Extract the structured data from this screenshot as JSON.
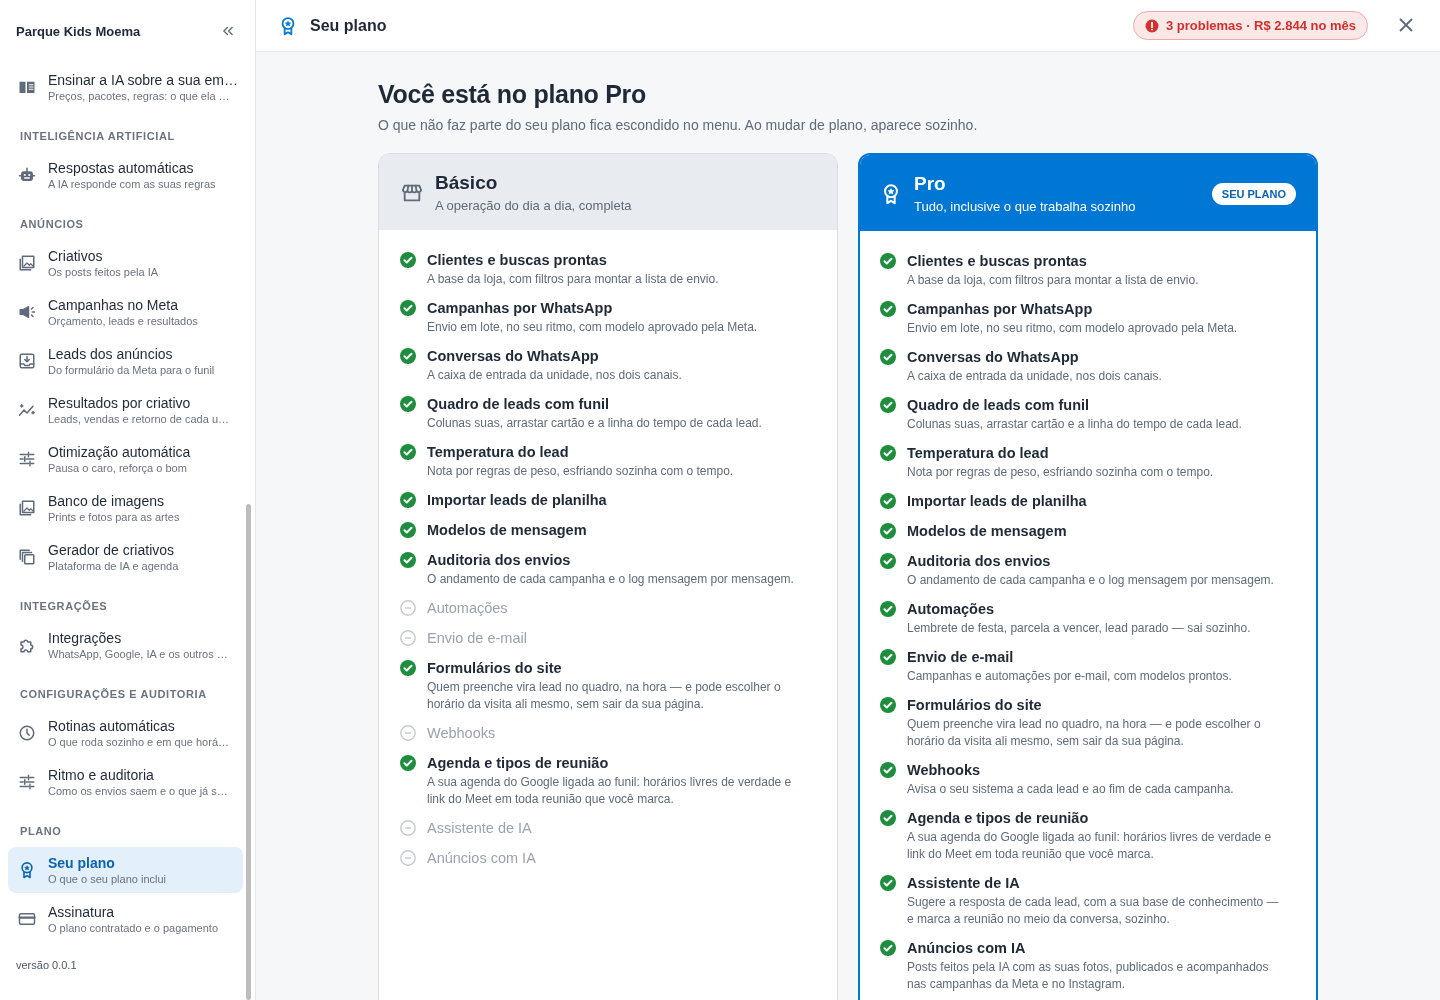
{
  "sidebar": {
    "brand": "Parque Kids Moema",
    "sections": [
      {
        "items": [
          {
            "title": "Ensinar a IA sobre a sua em…",
            "subtitle": "Preços, pacotes, regras: o que ela …",
            "selected": false
          }
        ]
      },
      {
        "heading": "INTELIGÊNCIA ARTIFICIAL",
        "items": [
          {
            "title": "Respostas automáticas",
            "subtitle": "A IA responde com as suas regras",
            "selected": false
          }
        ]
      },
      {
        "heading": "ANÚNCIOS",
        "items": [
          {
            "title": "Criativos",
            "subtitle": "Os posts feitos pela IA",
            "selected": false
          },
          {
            "title": "Campanhas no Meta",
            "subtitle": "Orçamento, leads e resultados",
            "selected": false
          },
          {
            "title": "Leads dos anúncios",
            "subtitle": "Do formulário da Meta para o funil",
            "selected": false
          },
          {
            "title": "Resultados por criativo",
            "subtitle": "Leads, vendas e retorno de cada u…",
            "selected": false
          },
          {
            "title": "Otimização automática",
            "subtitle": "Pausa o caro, reforça o bom",
            "selected": false
          },
          {
            "title": "Banco de imagens",
            "subtitle": "Prints e fotos para as artes",
            "selected": false
          },
          {
            "title": "Gerador de criativos",
            "subtitle": "Plataforma de IA e agenda",
            "selected": false
          }
        ]
      },
      {
        "heading": "INTEGRAÇÕES",
        "items": [
          {
            "title": "Integrações",
            "subtitle": "WhatsApp, Google, IA e os outros …",
            "selected": false
          }
        ]
      },
      {
        "heading": "CONFIGURAÇÕES E AUDITORIA",
        "items": [
          {
            "title": "Rotinas automáticas",
            "subtitle": "O que roda sozinho e em que horá…",
            "selected": false
          },
          {
            "title": "Ritmo e auditoria",
            "subtitle": "Como os envios saem e o que já s…",
            "selected": false
          }
        ]
      },
      {
        "heading": "PLANO",
        "items": [
          {
            "title": "Seu plano",
            "subtitle": "O que o seu plano inclui",
            "selected": true
          },
          {
            "title": "Assinatura",
            "subtitle": "O plano contratado e o pagamento",
            "selected": false
          }
        ]
      }
    ],
    "version": "versão 0.0.1"
  },
  "header": {
    "title": "Seu plano",
    "alert": "3 problemas · R$ 2.844 no mês"
  },
  "page": {
    "title": "Você está no plano Pro",
    "subtitle": "O que não faz parte do seu plano fica escondido no menu. Ao mudar de plano, aparece sozinho."
  },
  "plans": [
    {
      "name": "Básico",
      "tagline": "A operação do dia a dia, completa",
      "current": false,
      "features": [
        {
          "name": "Clientes e buscas prontas",
          "description": "A base da loja, com filtros para montar a lista de envio.",
          "included": true
        },
        {
          "name": "Campanhas por WhatsApp",
          "description": "Envio em lote, no seu ritmo, com modelo aprovado pela Meta.",
          "included": true
        },
        {
          "name": "Conversas do WhatsApp",
          "description": "A caixa de entrada da unidade, nos dois canais.",
          "included": true
        },
        {
          "name": "Quadro de leads com funil",
          "description": "Colunas suas, arrastar cartão e a linha do tempo de cada lead.",
          "included": true
        },
        {
          "name": "Temperatura do lead",
          "description": "Nota por regras de peso, esfriando sozinha com o tempo.",
          "included": true
        },
        {
          "name": "Importar leads de planilha",
          "included": true
        },
        {
          "name": "Modelos de mensagem",
          "included": true
        },
        {
          "name": "Auditoria dos envios",
          "description": "O andamento de cada campanha e o log mensagem por mensagem.",
          "included": true
        },
        {
          "name": "Automações",
          "included": false
        },
        {
          "name": "Envio de e-mail",
          "included": false
        },
        {
          "name": "Formulários do site",
          "description": "Quem preenche vira lead no quadro, na hora — e pode escolher o horário da visita ali mesmo, sem sair da sua página.",
          "included": true
        },
        {
          "name": "Webhooks",
          "included": false
        },
        {
          "name": "Agenda e tipos de reunião",
          "description": "A sua agenda do Google ligada ao funil: horários livres de verdade e link do Meet em toda reunião que você marca.",
          "included": true
        },
        {
          "name": "Assistente de IA",
          "included": false
        },
        {
          "name": "Anúncios com IA",
          "included": false
        }
      ]
    },
    {
      "name": "Pro",
      "tagline": "Tudo, inclusive o que trabalha sozinho",
      "current": true,
      "badge": "SEU PLANO",
      "features": [
        {
          "name": "Clientes e buscas prontas",
          "description": "A base da loja, com filtros para montar a lista de envio.",
          "included": true
        },
        {
          "name": "Campanhas por WhatsApp",
          "description": "Envio em lote, no seu ritmo, com modelo aprovado pela Meta.",
          "included": true
        },
        {
          "name": "Conversas do WhatsApp",
          "description": "A caixa de entrada da unidade, nos dois canais.",
          "included": true
        },
        {
          "name": "Quadro de leads com funil",
          "description": "Colunas suas, arrastar cartão e a linha do tempo de cada lead.",
          "included": true
        },
        {
          "name": "Temperatura do lead",
          "description": "Nota por regras de peso, esfriando sozinha com o tempo.",
          "included": true
        },
        {
          "name": "Importar leads de planilha",
          "included": true
        },
        {
          "name": "Modelos de mensagem",
          "included": true
        },
        {
          "name": "Auditoria dos envios",
          "description": "O andamento de cada campanha e o log mensagem por mensagem.",
          "included": true
        },
        {
          "name": "Automações",
          "description": "Lembrete de festa, parcela a vencer, lead parado — sai sozinho.",
          "included": true
        },
        {
          "name": "Envio de e-mail",
          "description": "Campanhas e automações por e-mail, com modelos prontos.",
          "included": true
        },
        {
          "name": "Formulários do site",
          "description": "Quem preenche vira lead no quadro, na hora — e pode escolher o horário da visita ali mesmo, sem sair da sua página.",
          "included": true
        },
        {
          "name": "Webhooks",
          "description": "Avisa o seu sistema a cada lead e ao fim de cada campanha.",
          "included": true
        },
        {
          "name": "Agenda e tipos de reunião",
          "description": "A sua agenda do Google ligada ao funil: horários livres de verdade e link do Meet em toda reunião que você marca.",
          "included": true
        },
        {
          "name": "Assistente de IA",
          "description": "Sugere a resposta de cada lead, com a sua base de conhecimento — e marca a reunião no meio da conversa, sozinho.",
          "included": true
        },
        {
          "name": "Anúncios com IA",
          "description": "Posts feitos pela IA com as suas fotos, publicados e acompanhados nas campanhas da Meta e no Instagram.",
          "included": true
        }
      ]
    }
  ]
}
